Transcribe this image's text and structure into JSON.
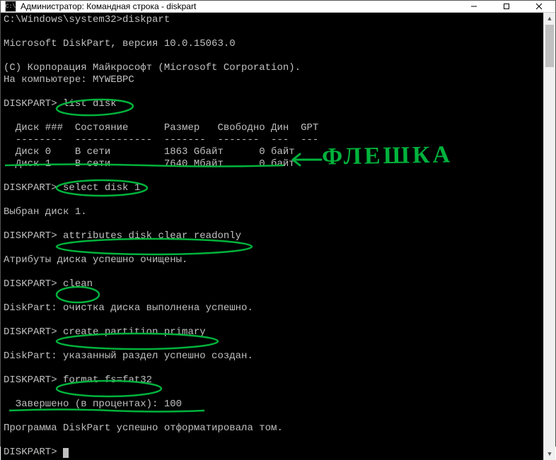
{
  "titlebar": {
    "icon_label": "CMD",
    "title": "Администратор: Командная строка - diskpart"
  },
  "controls": {
    "minimize": "—",
    "maximize": "☐",
    "close": "✕"
  },
  "terminal": {
    "line_path": "C:\\Windows\\system32>diskpart",
    "line_version": "Microsoft DiskPart, версия 10.0.15063.0",
    "line_copyright": "(C) Корпорация Майкрософт (Microsoft Corporation).",
    "line_computer": "На компьютере: MYWEBPC",
    "prompt": "DISKPART>",
    "cmd_list": "list disk",
    "table_header": "  Диск ###  Состояние      Размер   Свободно Дин  GPT",
    "table_divider": "  --------  -------------  -------  -------  ---  ---",
    "table_row0": "  Диск 0    В сети         1863 Gбайт      0 байт",
    "table_row1": "  Диск 1    В сети         7640 Mбайт      0 байт",
    "cmd_select": "select disk 1",
    "resp_select": "Выбран диск 1.",
    "cmd_attr": "attributes disk clear readonly",
    "resp_attr": "Атрибуты диска успешно очищены.",
    "cmd_clean": "clean",
    "resp_clean": "DiskPart: очистка диска выполнена успешно.",
    "cmd_create": "create partition primary",
    "resp_create": "DiskPart: указанный раздел успешно создан.",
    "cmd_format": "format fs=fat32",
    "resp_progress": "  Завершено (в процентах): 100",
    "resp_format_done": "Программа DiskPart успешно отформатировала том.",
    "final_prompt": "DISKPART> "
  },
  "annotations": {
    "handwritten_label": "ФЛЕШКА",
    "stroke_color": "#00b33c"
  }
}
